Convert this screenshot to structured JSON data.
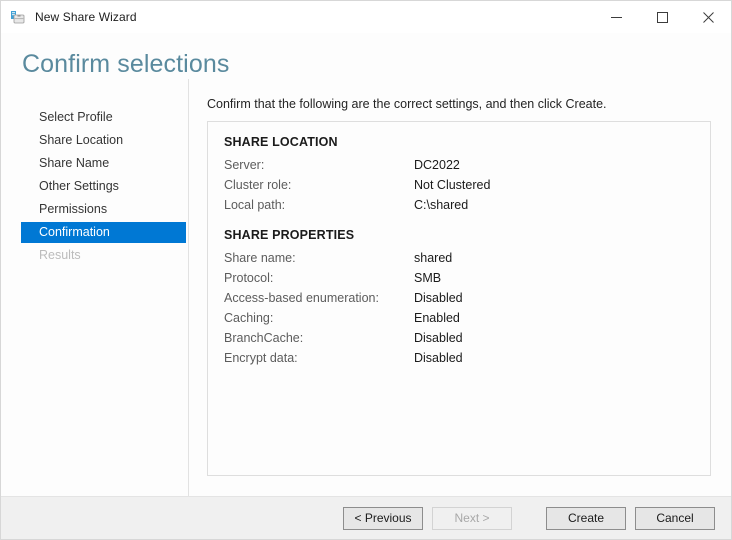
{
  "window": {
    "title": "New Share Wizard",
    "icon": "share-folder-icon",
    "controls": {
      "minimize": "minimize-icon",
      "maximize": "maximize-icon",
      "close": "close-icon"
    }
  },
  "page": {
    "heading": "Confirm selections",
    "heading_color": "#5a8a9e",
    "intro": "Confirm that the following are the correct settings, and then click Create."
  },
  "nav": {
    "items": [
      {
        "label": "Select Profile",
        "state": "normal"
      },
      {
        "label": "Share Location",
        "state": "normal"
      },
      {
        "label": "Share Name",
        "state": "normal"
      },
      {
        "label": "Other Settings",
        "state": "normal"
      },
      {
        "label": "Permissions",
        "state": "normal"
      },
      {
        "label": "Confirmation",
        "state": "selected"
      },
      {
        "label": "Results",
        "state": "disabled"
      }
    ],
    "selected_color": "#0078d4"
  },
  "summary": {
    "sections": [
      {
        "title": "SHARE LOCATION",
        "rows": [
          {
            "label": "Server:",
            "value": "DC2022"
          },
          {
            "label": "Cluster role:",
            "value": "Not Clustered"
          },
          {
            "label": "Local path:",
            "value": "C:\\shared"
          }
        ]
      },
      {
        "title": "SHARE PROPERTIES",
        "rows": [
          {
            "label": "Share name:",
            "value": "shared"
          },
          {
            "label": "Protocol:",
            "value": "SMB"
          },
          {
            "label": "Access-based enumeration:",
            "value": "Disabled"
          },
          {
            "label": "Caching:",
            "value": "Enabled"
          },
          {
            "label": "BranchCache:",
            "value": "Disabled"
          },
          {
            "label": "Encrypt data:",
            "value": "Disabled"
          }
        ]
      }
    ]
  },
  "footer": {
    "previous_label": "< Previous",
    "next_label": "Next >",
    "next_disabled": true,
    "create_label": "Create",
    "cancel_label": "Cancel"
  }
}
